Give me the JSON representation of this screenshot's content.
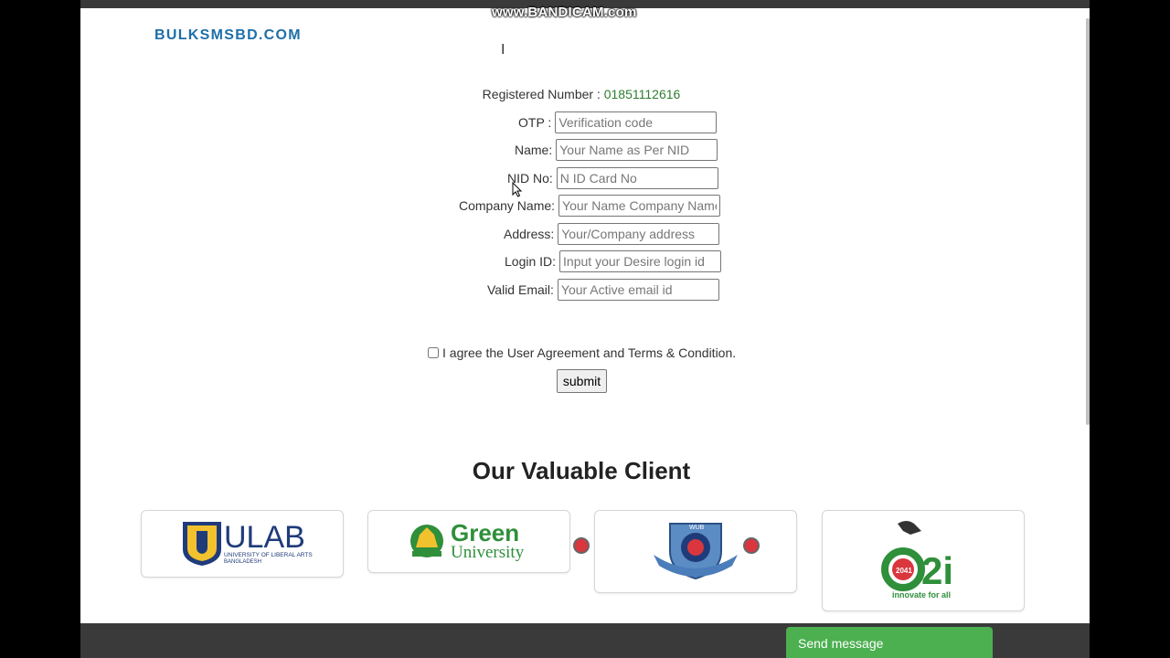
{
  "watermark": "www.BANDICAM.com",
  "site_logo": "BULKSMSBD.COM",
  "registered": {
    "label": "Registered Number : ",
    "number": "01851112616"
  },
  "form": [
    {
      "key": "otp",
      "label": "OTP :",
      "placeholder": "Verification code"
    },
    {
      "key": "name",
      "label": "Name:",
      "placeholder": "Your Name as Per NID"
    },
    {
      "key": "nid",
      "label": "NID No:",
      "placeholder": "N ID Card No"
    },
    {
      "key": "company",
      "label": "Company Name:",
      "placeholder": "Your Name Company Name"
    },
    {
      "key": "address",
      "label": "Address:",
      "placeholder": "Your/Company address"
    },
    {
      "key": "login",
      "label": "Login ID:",
      "placeholder": "Input your Desire login id"
    },
    {
      "key": "email",
      "label": "Valid Email:",
      "placeholder": "Your Active email id"
    }
  ],
  "agreement": "I agree the User Agreement and Terms & Condition.",
  "submit_label": "submit",
  "clients": {
    "title": "Our Valuable Client",
    "ulab": {
      "name": "ULAB",
      "sub1": "UNIVERSITY OF LIBERAL ARTS",
      "sub2": "BANGLADESH"
    },
    "green": {
      "line1": "Green",
      "line2": "University"
    },
    "wub": {
      "text": "WUB"
    },
    "a2i": {
      "badge": "2041",
      "name": "a2i",
      "tagline": "innovate for all"
    }
  },
  "send_message": "Send message",
  "colors": {
    "accent_green": "#4caf50",
    "logo_blue": "#1e6fa8",
    "number_green": "#2e7d32"
  }
}
